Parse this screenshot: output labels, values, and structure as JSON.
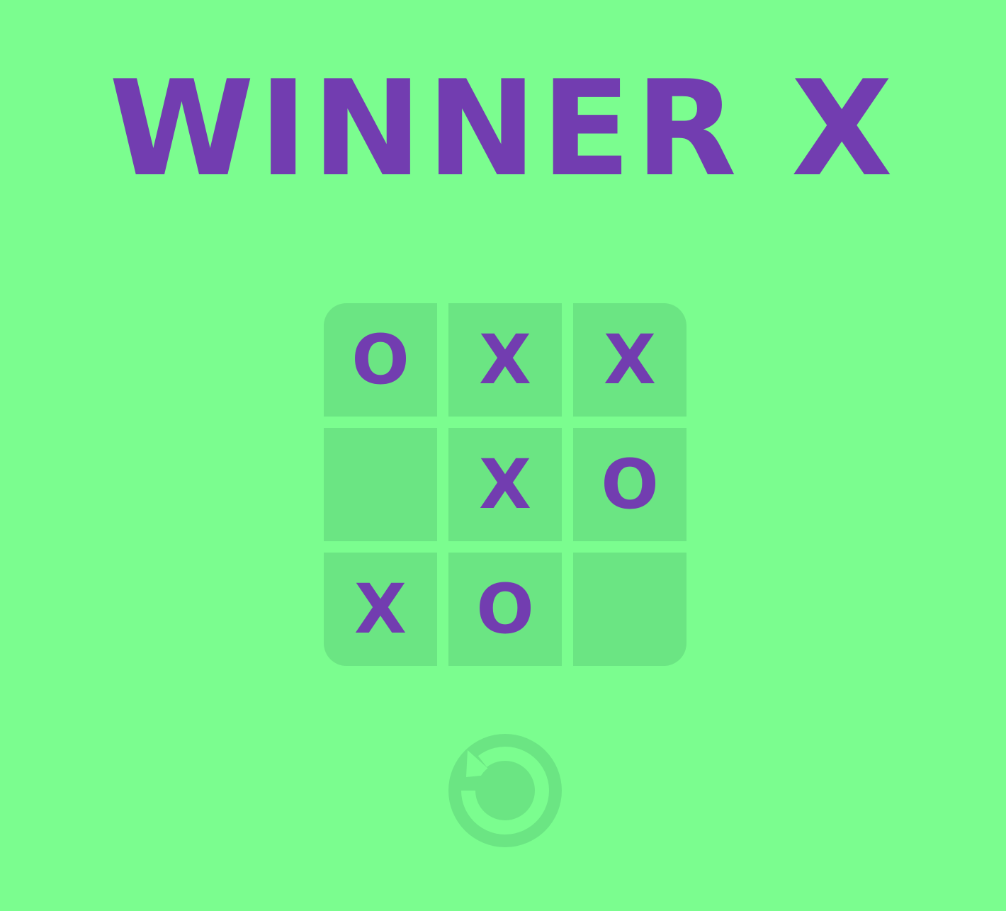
{
  "status": {
    "text": "WINNER X"
  },
  "board": {
    "cells": [
      "O",
      "X",
      "X",
      "",
      "X",
      "O",
      "X",
      "O",
      ""
    ]
  },
  "restart": {
    "icon": "restart-icon"
  },
  "colors": {
    "background": "#7bfd8f",
    "cell": "#6be583",
    "mark": "#723db0"
  }
}
